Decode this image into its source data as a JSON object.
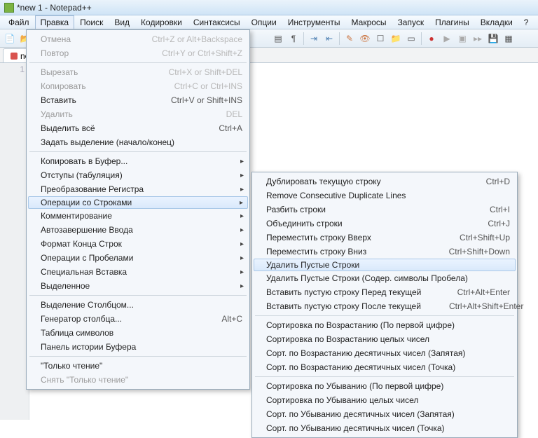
{
  "title": "*new 1 - Notepad++",
  "menubar": [
    "Файл",
    "Правка",
    "Поиск",
    "Вид",
    "Кодировки",
    "Синтаксисы",
    "Опции",
    "Инструменты",
    "Макросы",
    "Запуск",
    "Плагины",
    "Вкладки",
    "?"
  ],
  "tab": {
    "label": "new 1"
  },
  "gutter_line": "1",
  "edit_menu": [
    {
      "kind": "item",
      "label": "Отмена",
      "shortcut": "Ctrl+Z or Alt+Backspace",
      "disabled": true
    },
    {
      "kind": "item",
      "label": "Повтор",
      "shortcut": "Ctrl+Y or Ctrl+Shift+Z",
      "disabled": true
    },
    {
      "kind": "sep"
    },
    {
      "kind": "item",
      "label": "Вырезать",
      "shortcut": "Ctrl+X or Shift+DEL",
      "disabled": true
    },
    {
      "kind": "item",
      "label": "Копировать",
      "shortcut": "Ctrl+C or Ctrl+INS",
      "disabled": true
    },
    {
      "kind": "item",
      "label": "Вставить",
      "shortcut": "Ctrl+V or Shift+INS"
    },
    {
      "kind": "item",
      "label": "Удалить",
      "shortcut": "DEL",
      "disabled": true
    },
    {
      "kind": "item",
      "label": "Выделить всё",
      "shortcut": "Ctrl+A"
    },
    {
      "kind": "item",
      "label": "Задать выделение (начало/конец)"
    },
    {
      "kind": "sep"
    },
    {
      "kind": "sub",
      "label": "Копировать в Буфер..."
    },
    {
      "kind": "sub",
      "label": "Отступы (табуляция)"
    },
    {
      "kind": "sub",
      "label": "Преобразование Регистра"
    },
    {
      "kind": "sub",
      "label": "Операции со Строками",
      "highlight": true
    },
    {
      "kind": "sub",
      "label": "Комментирование"
    },
    {
      "kind": "sub",
      "label": "Автозавершение Ввода"
    },
    {
      "kind": "sub",
      "label": "Формат Конца Строк"
    },
    {
      "kind": "sub",
      "label": "Операции с Пробелами"
    },
    {
      "kind": "sub",
      "label": "Специальная Вставка"
    },
    {
      "kind": "sub",
      "label": "Выделенное"
    },
    {
      "kind": "sep"
    },
    {
      "kind": "item",
      "label": "Выделение Столбцом..."
    },
    {
      "kind": "item",
      "label": "Генератор столбца...",
      "shortcut": "Alt+C"
    },
    {
      "kind": "item",
      "label": "Таблица символов"
    },
    {
      "kind": "item",
      "label": "Панель истории Буфера"
    },
    {
      "kind": "sep"
    },
    {
      "kind": "item",
      "label": "\"Только чтение\""
    },
    {
      "kind": "item",
      "label": "Снять \"Только чтение\"",
      "disabled": true
    }
  ],
  "line_menu": [
    {
      "kind": "item",
      "label": "Дублировать текущую строку",
      "shortcut": "Ctrl+D"
    },
    {
      "kind": "item",
      "label": "Remove Consecutive Duplicate Lines"
    },
    {
      "kind": "item",
      "label": "Разбить строки",
      "shortcut": "Ctrl+I"
    },
    {
      "kind": "item",
      "label": "Объединить строки",
      "shortcut": "Ctrl+J"
    },
    {
      "kind": "item",
      "label": "Переместить строку Вверх",
      "shortcut": "Ctrl+Shift+Up"
    },
    {
      "kind": "item",
      "label": "Переместить строку Вниз",
      "shortcut": "Ctrl+Shift+Down"
    },
    {
      "kind": "item",
      "label": "Удалить Пустые Строки",
      "highlight": true
    },
    {
      "kind": "item",
      "label": "Удалить Пустые Строки (Содер. символы Пробела)"
    },
    {
      "kind": "item",
      "label": "Вставить пустую строку Перед текущей",
      "shortcut": "Ctrl+Alt+Enter"
    },
    {
      "kind": "item",
      "label": "Вставить пустую строку После текущей",
      "shortcut": "Ctrl+Alt+Shift+Enter"
    },
    {
      "kind": "sep"
    },
    {
      "kind": "item",
      "label": "Сортировка по Возрастанию (По первой цифре)"
    },
    {
      "kind": "item",
      "label": "Сортировка по Возрастанию целых чисел"
    },
    {
      "kind": "item",
      "label": "Сорт. по Возрастанию десятичных чисел (Запятая)"
    },
    {
      "kind": "item",
      "label": "Сорт. по Возрастанию десятичных чисел (Точка)"
    },
    {
      "kind": "sep"
    },
    {
      "kind": "item",
      "label": "Сортировка по Убыванию (По первой цифре)"
    },
    {
      "kind": "item",
      "label": "Сортировка по Убыванию целых чисел"
    },
    {
      "kind": "item",
      "label": "Сорт. по Убыванию десятичных чисел (Запятая)"
    },
    {
      "kind": "item",
      "label": "Сорт. по Убыванию десятичных чисел (Точка)"
    }
  ]
}
